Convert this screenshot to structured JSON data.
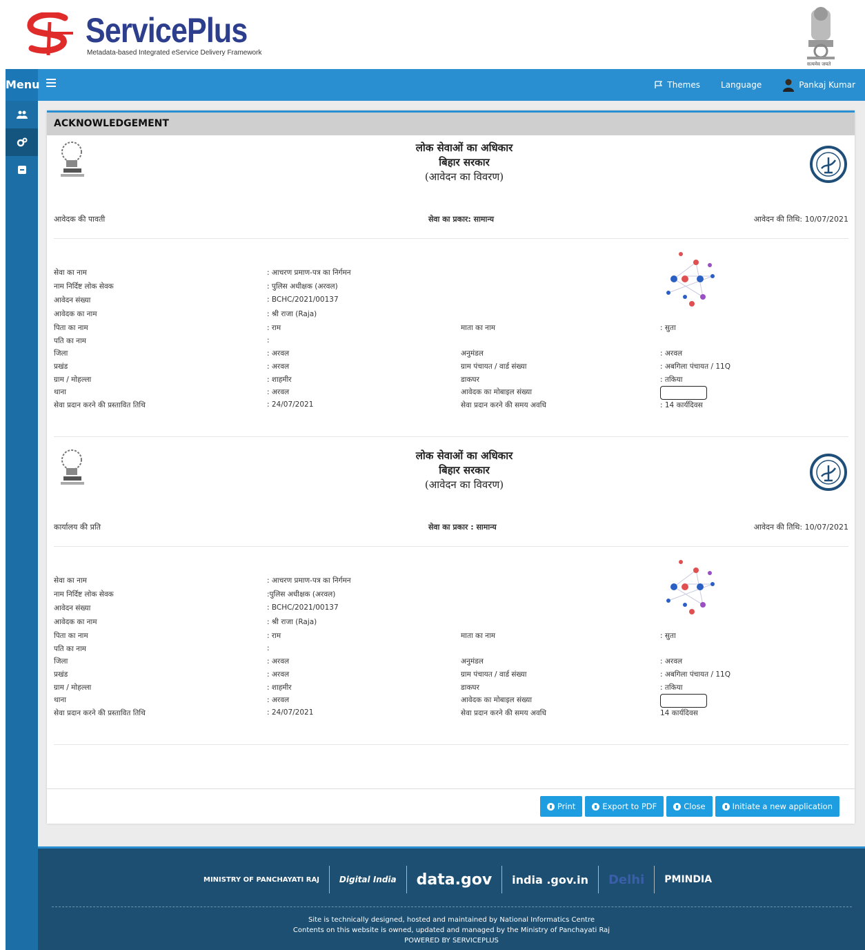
{
  "header": {
    "brand": "ServicePlus",
    "tagline": "Metadata-based Integrated eService Delivery Framework",
    "emblem_caption": "सत्यमेव जयते"
  },
  "navbar": {
    "menu_label": "Menu",
    "themes": "Themes",
    "language": "Language",
    "user": "Pankaj Kumar"
  },
  "page": {
    "title": "ACKNOWLEDGEMENT"
  },
  "acks": [
    {
      "title1": "लोक सेवाओं का अधिकार",
      "title2": "बिहार सरकार",
      "title3": "(आवेदन का विवरण)",
      "copy": "आवेदक की पावती",
      "service_type": "सेवा का प्रकार: सामान्य",
      "date": "आवेदन की तिथि: 10/07/2021",
      "rows": [
        [
          "सेवा का नाम",
          ": आचरण प्रमाण-पत्र का निर्गमन",
          "",
          ""
        ],
        [
          "नाम निर्दिष्ट लोक सेवक",
          ": पुलिस अधीक्षक (अरवल)",
          "",
          ""
        ],
        [
          "आवेदन संख्या",
          ": BCHC/2021/00137",
          "",
          ""
        ],
        [
          "आवेदक का नाम",
          ": श्री राजा (Raja)",
          "",
          ""
        ],
        [
          "पिता का नाम",
          ": राम",
          "माता का नाम",
          ": सुता"
        ],
        [
          "पति का नाम",
          ":",
          "",
          ""
        ],
        [
          "जिला",
          ": अरवल",
          "अनुमंडल",
          ": अरवल"
        ],
        [
          "प्रखंड",
          ": अरवल",
          "ग्राम पंचायत / वार्ड संख्या",
          ": अबगिला पंचायत / 11Q"
        ],
        [
          "ग्राम / मोहल्ला",
          ": शाहमीर",
          "डाकघर",
          ": तकिया"
        ],
        [
          "थाना",
          ": अरवल",
          "आवेदक का मोबाइल संख्या",
          ""
        ],
        [
          "सेवा प्रदान करने की प्रस्तावित तिथि",
          ": 24/07/2021",
          "सेवा प्रदान करने की समय अवधि",
          ": 14 कार्यदिवस"
        ]
      ]
    },
    {
      "title1": "लोक सेवाओं का अधिकार",
      "title2": "बिहार सरकार",
      "title3": "(आवेदन का विवरण)",
      "copy": "कार्यालय की प्रति",
      "service_type": "सेवा का प्रकार : सामान्य",
      "date": "आवेदन की तिथि: 10/07/2021",
      "rows": [
        [
          "सेवा का नाम",
          ": आचरण प्रमाण-पत्र का निर्गमन",
          "",
          ""
        ],
        [
          "नाम निर्दिष्ट लोक सेवक",
          ":पुलिस अधीक्षक (अरवल)",
          "",
          ""
        ],
        [
          "आवेदन संख्या",
          ": BCHC/2021/00137",
          "",
          ""
        ],
        [
          "आवेदक का नाम",
          ": श्री राजा (Raja)",
          "",
          ""
        ],
        [
          "पिता का नाम",
          ": राम",
          "माता का नाम",
          ": सुता"
        ],
        [
          "पति का नाम",
          ":",
          "",
          ""
        ],
        [
          "जिला",
          ": अरवल",
          "अनुमंडल",
          ": अरवल"
        ],
        [
          "प्रखंड",
          ": अरवल",
          "ग्राम पंचायत / वार्ड संख्या",
          ": अबगिला पंचायत / 11Q"
        ],
        [
          "ग्राम / मोहल्ला",
          ": शाहमीर",
          "डाकघर",
          ": तकिया"
        ],
        [
          "थाना",
          ": अरवल",
          "आवेदक का मोबाइल संख्या",
          ""
        ],
        [
          "सेवा प्रदान करने की प्रस्तावित तिथि",
          ": 24/07/2021",
          "सेवा प्रदान करने की समय अवधि",
          "14 कार्यदिवस"
        ]
      ]
    }
  ],
  "buttons": {
    "print": "Print",
    "export": "Export to PDF",
    "close": "Close",
    "initiate": "Initiate a new application"
  },
  "footer": {
    "logo1": "MINISTRY OF PANCHAYATI RAJ",
    "logo2": "Digital India",
    "logo3": "data.gov",
    "logo4": "india .gov.in",
    "logo5": "Delhi",
    "logo6": "PMINDIA",
    "line1": "Site is technically designed, hosted and maintained by National Informatics Centre",
    "line2": "Contents on this website is owned, updated and managed by the Ministry of Panchayati Raj",
    "line3": "POWERED BY SERVICEPLUS"
  },
  "colors": {
    "nav_blue": "#2a8fd0",
    "sidebar": "#1b6fa6",
    "button": "#1e9ee0",
    "footer": "#1c4f72",
    "brand": "#2c3e8c",
    "logo_red": "#e02b2b"
  }
}
